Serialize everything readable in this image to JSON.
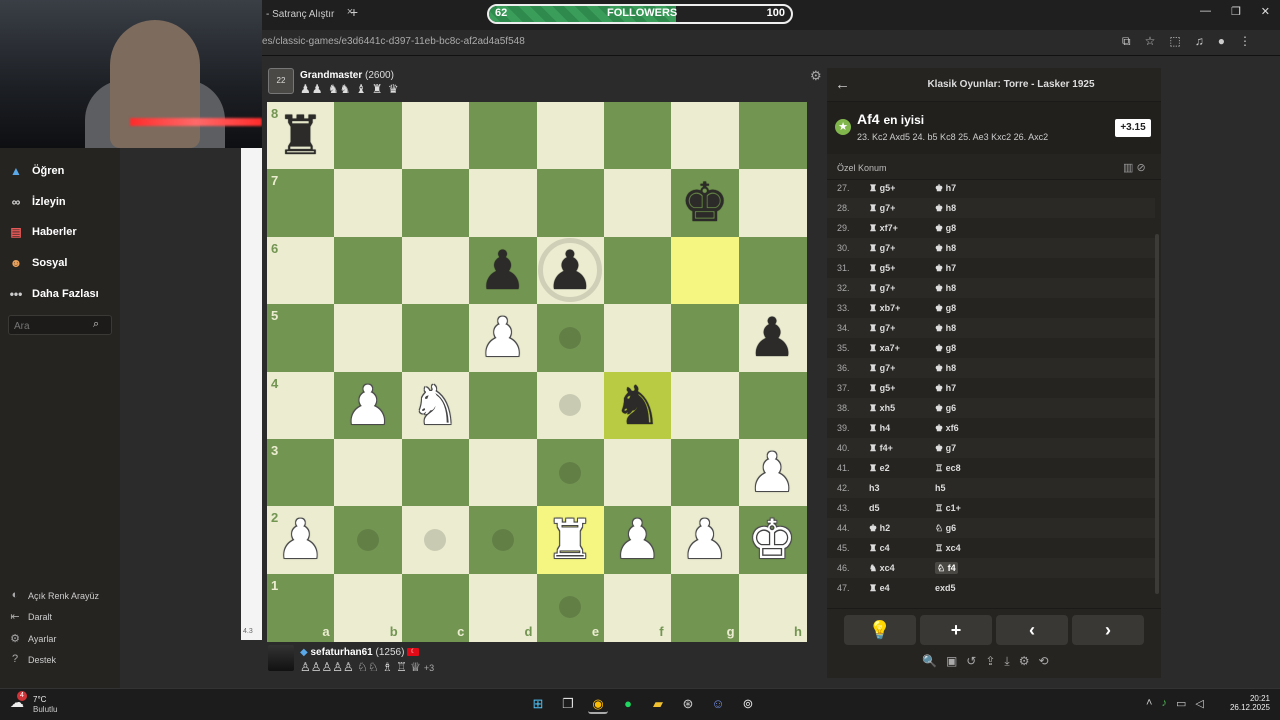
{
  "browser": {
    "tab_title": "- Satranç Alıştır",
    "tab_close": "×",
    "new_tab": "+",
    "url": "es/classic-games/e3d6441c-d397-11eb-bc8c-af2ad4a5f548",
    "window_controls": [
      "—",
      "❐",
      "✕"
    ]
  },
  "followers": {
    "current": "62",
    "label": "FOLLOWERS",
    "goal": "100",
    "progress": 0.62
  },
  "sidebar": {
    "items": [
      {
        "label": "Öğren",
        "icon": "graduation-icon"
      },
      {
        "label": "İzleyin",
        "icon": "binoculars-icon"
      },
      {
        "label": "Haberler",
        "icon": "newspaper-icon"
      },
      {
        "label": "Sosyal",
        "icon": "people-icon"
      },
      {
        "label": "Daha Fazlası",
        "icon": "more-icon"
      }
    ],
    "search_placeholder": "Ara",
    "footer": [
      {
        "label": "Açık Renk Arayüz",
        "icon": "theme-icon"
      },
      {
        "label": "Daralt",
        "icon": "collapse-icon"
      },
      {
        "label": "Ayarlar",
        "icon": "gear-icon"
      },
      {
        "label": "Destek",
        "icon": "help-icon"
      }
    ],
    "strip_text": "4.3"
  },
  "top_player": {
    "avatar_text": "22",
    "name": "Grandmaster",
    "rating": "(2600)",
    "captured": "♟♟ ♞♞ ♝ ♜ ♛"
  },
  "bottom_player": {
    "name": "sefaturhan61",
    "rating": "(1256)",
    "captured": "♙♙♙♙♙ ♘♘ ♗ ♖ ♕",
    "advantage": "+3",
    "flag": "TR"
  },
  "board": {
    "files": [
      "a",
      "b",
      "c",
      "d",
      "e",
      "f",
      "g",
      "h"
    ],
    "ranks": [
      "8",
      "7",
      "6",
      "5",
      "4",
      "3",
      "2",
      "1"
    ],
    "pieces": [
      {
        "sq": "a8",
        "color": "b",
        "glyph": "♜"
      },
      {
        "sq": "g7",
        "color": "b",
        "glyph": "♚"
      },
      {
        "sq": "d6",
        "color": "b",
        "glyph": "♟"
      },
      {
        "sq": "e6",
        "color": "b",
        "glyph": "♟"
      },
      {
        "sq": "d5",
        "color": "w",
        "glyph": "♟"
      },
      {
        "sq": "h5",
        "color": "b",
        "glyph": "♟"
      },
      {
        "sq": "b4",
        "color": "w",
        "glyph": "♟"
      },
      {
        "sq": "c4",
        "color": "w",
        "glyph": "♞"
      },
      {
        "sq": "f4",
        "color": "b",
        "glyph": "♞"
      },
      {
        "sq": "h3",
        "color": "w",
        "glyph": "♟"
      },
      {
        "sq": "a2",
        "color": "w",
        "glyph": "♟"
      },
      {
        "sq": "e2",
        "color": "w",
        "glyph": "♜"
      },
      {
        "sq": "f2",
        "color": "w",
        "glyph": "♟"
      },
      {
        "sq": "g2",
        "color": "w",
        "glyph": "♟"
      },
      {
        "sq": "h2",
        "color": "w",
        "glyph": "♚"
      }
    ],
    "highlights": [
      "g6",
      "f4",
      "e2"
    ],
    "dots": [
      "e5",
      "e4",
      "e3",
      "b2",
      "c2",
      "d2",
      "e1"
    ],
    "rings": [
      "e6"
    ]
  },
  "panel": {
    "back": "←",
    "title": "Klasik Oyunlar: Torre - Lasker 1925",
    "best_move": "Af4",
    "best_label": "en iyisi",
    "best_line": "23. Kc2 Axd5 24. b5 Kc8 25. Ae3 Kxc2 26. Axc2",
    "eval": "+3.15",
    "position_label": "Özel Konum",
    "moves": [
      {
        "n": "27.",
        "w": "♜ g5+",
        "b": "♚ h7"
      },
      {
        "n": "28.",
        "w": "♜ g7+",
        "b": "♚ h8"
      },
      {
        "n": "29.",
        "w": "♜ xf7+",
        "b": "♚ g8"
      },
      {
        "n": "30.",
        "w": "♜ g7+",
        "b": "♚ h8"
      },
      {
        "n": "31.",
        "w": "♜ g5+",
        "b": "♚ h7"
      },
      {
        "n": "32.",
        "w": "♜ g7+",
        "b": "♚ h8"
      },
      {
        "n": "33.",
        "w": "♜ xb7+",
        "b": "♚ g8"
      },
      {
        "n": "34.",
        "w": "♜ g7+",
        "b": "♚ h8"
      },
      {
        "n": "35.",
        "w": "♜ xa7+",
        "b": "♚ g8"
      },
      {
        "n": "36.",
        "w": "♜ g7+",
        "b": "♚ h8"
      },
      {
        "n": "37.",
        "w": "♜ g5+",
        "b": "♚ h7"
      },
      {
        "n": "38.",
        "w": "♜ xh5",
        "b": "♚ g6"
      },
      {
        "n": "39.",
        "w": "♜ h4",
        "b": "♚ xf6"
      },
      {
        "n": "40.",
        "w": "♜ f4+",
        "b": "♚ g7"
      },
      {
        "n": "41.",
        "w": "♜ e2",
        "b": "♖ ec8"
      },
      {
        "n": "42.",
        "w": "h3",
        "b": "h5"
      },
      {
        "n": "43.",
        "w": "d5",
        "b": "♖ c1+"
      },
      {
        "n": "44.",
        "w": "♚ h2",
        "b": "♘ g6"
      },
      {
        "n": "45.",
        "w": "♜ c4",
        "b": "♖ xc4"
      },
      {
        "n": "46.",
        "w": "♞ xc4",
        "b": "♘ f4"
      },
      {
        "n": "47.",
        "w": "♜ e4",
        "b": "exd5"
      }
    ],
    "controls": [
      "💡",
      "+",
      "‹",
      "›"
    ],
    "tools": [
      "🔍",
      "▣",
      "↺",
      "⇪",
      "⤓",
      "⚙",
      "⟲"
    ]
  },
  "taskbar": {
    "weather_temp": "7°C",
    "weather_desc": "Bulutlu",
    "weather_badge": "4",
    "time": "20:21",
    "date": "26.12.2025"
  }
}
